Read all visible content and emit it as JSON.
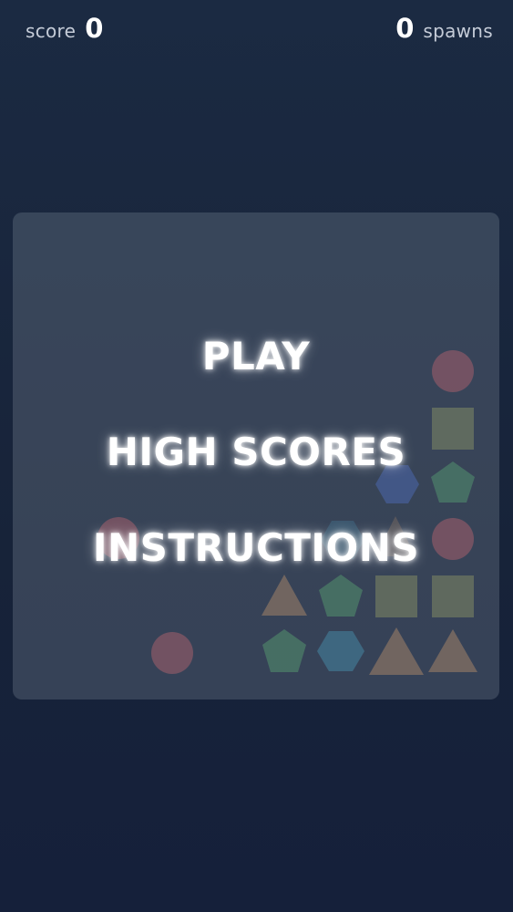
{
  "hud": {
    "score_label": "score",
    "score_value": "0",
    "spawns_value": "0",
    "spawns_label": "spawns"
  },
  "menu": {
    "play": "PLAY",
    "high_scores": "HIGH SCORES",
    "instructions": "INSTRUCTIONS"
  },
  "colors": {
    "background": "#1b2a42",
    "red": "#d0505a",
    "green": "#46a860",
    "blue": "#3a64c8",
    "teal": "#2f8fb5",
    "orange": "#c58a55",
    "olive": "#8e9650"
  },
  "board_pieces": [
    {
      "shape": "circle",
      "color": "red"
    },
    {
      "shape": "square",
      "color": "olive"
    },
    {
      "shape": "hexagon",
      "color": "blue"
    },
    {
      "shape": "pentagon",
      "color": "green"
    },
    {
      "shape": "circle",
      "color": "red"
    },
    {
      "shape": "circle",
      "color": "red"
    },
    {
      "shape": "triangle",
      "color": "orange"
    },
    {
      "shape": "pentagon",
      "color": "green"
    },
    {
      "shape": "square",
      "color": "olive"
    },
    {
      "shape": "square",
      "color": "olive"
    },
    {
      "shape": "circle",
      "color": "red"
    },
    {
      "shape": "pentagon",
      "color": "green"
    },
    {
      "shape": "hexagon",
      "color": "teal"
    },
    {
      "shape": "triangle",
      "color": "orange"
    },
    {
      "shape": "triangle",
      "color": "orange"
    }
  ]
}
